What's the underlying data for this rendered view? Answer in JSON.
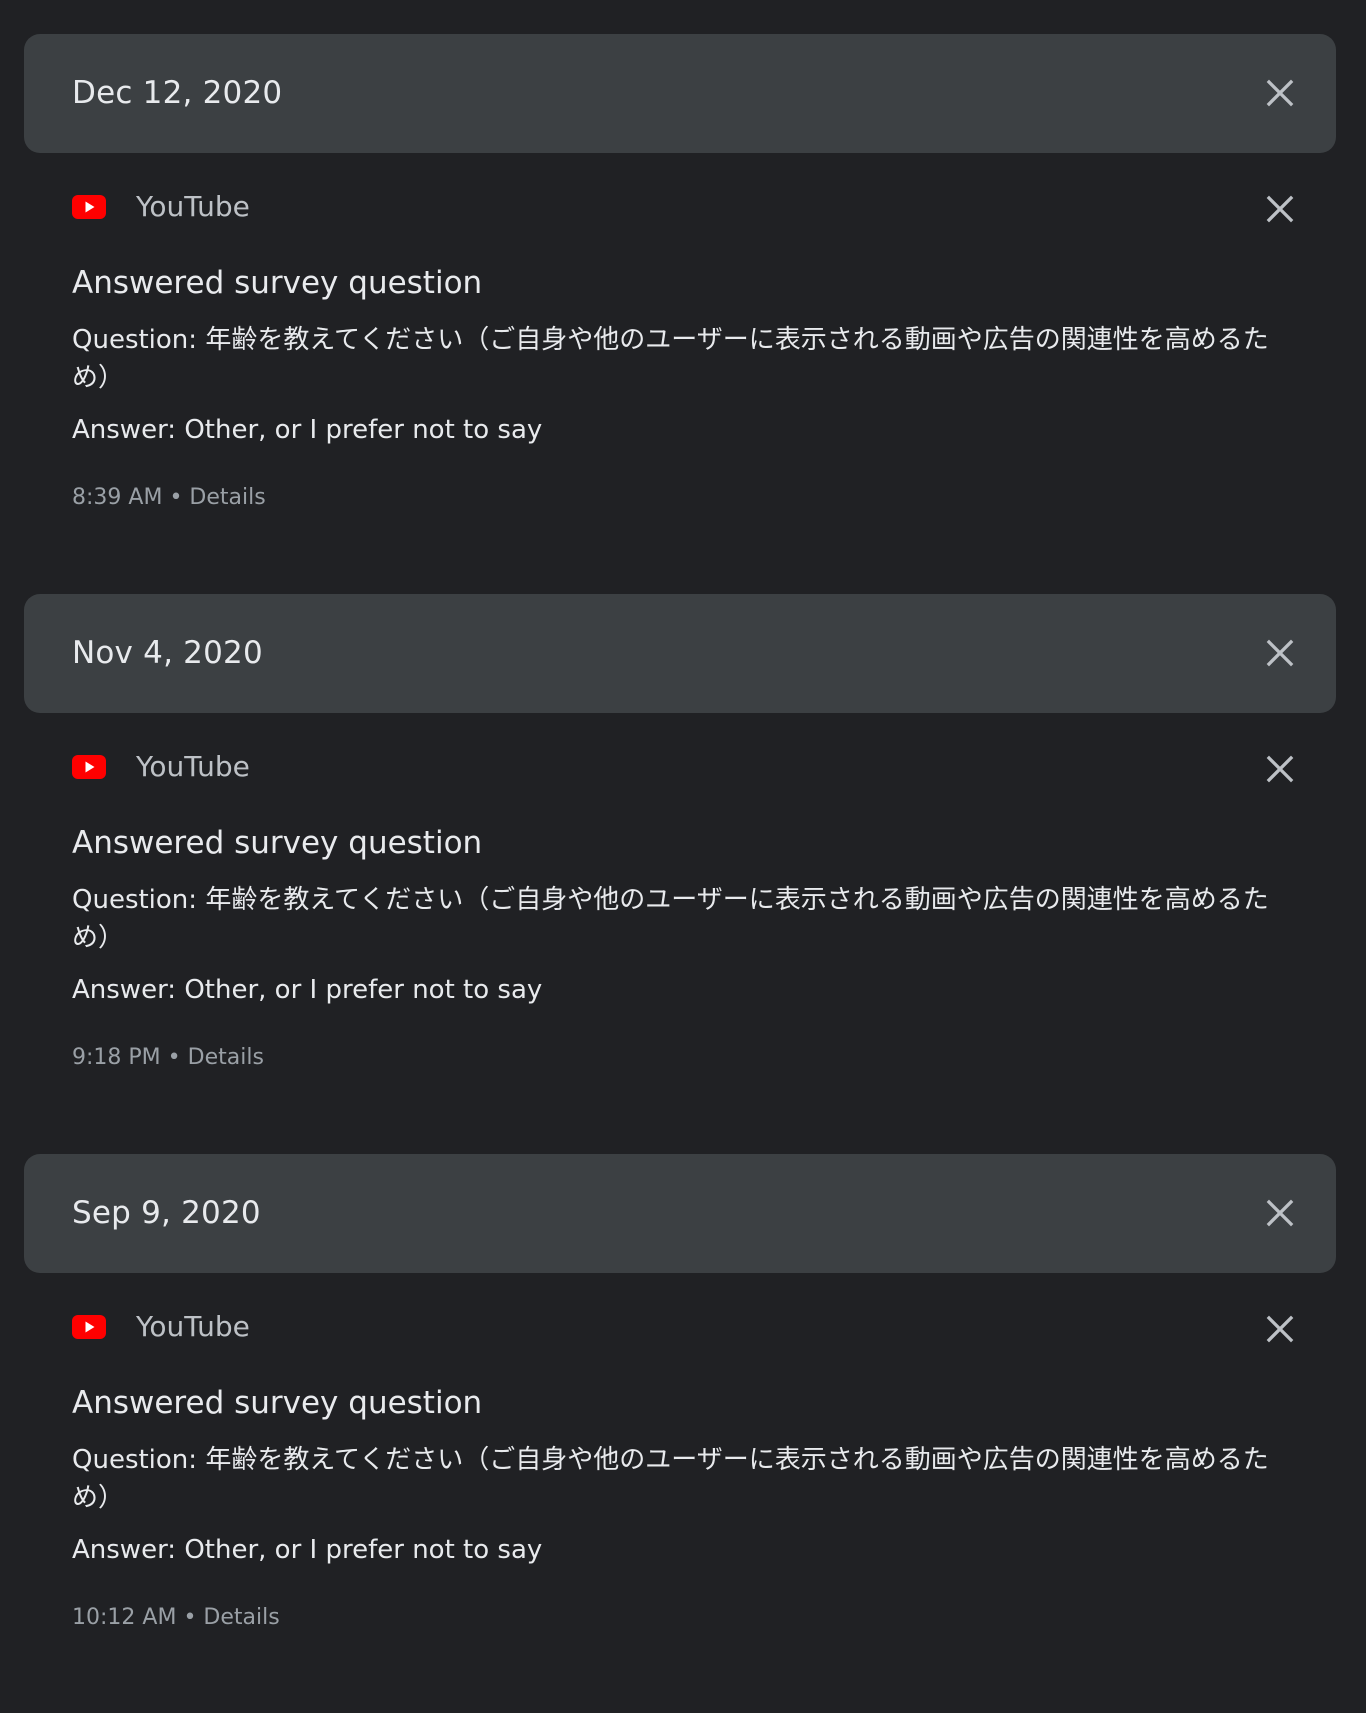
{
  "colors": {
    "background": "#202124",
    "header_bg": "#3c4043",
    "youtube_red": "#ff0000",
    "text_primary": "#e8eaed",
    "text_secondary": "#9aa0a6"
  },
  "groups": [
    {
      "date": "Dec 12, 2020",
      "item": {
        "product": "YouTube",
        "product_icon": "youtube-icon",
        "title": "Answered survey question",
        "question": "Question: 年齢を教えてください（ご自身や他のユーザーに表示される動画や広告の関連性を高めるため）",
        "answer": "Answer: Other, or I prefer not to say",
        "time": "8:39 AM",
        "separator": "•",
        "details_label": "Details"
      }
    },
    {
      "date": "Nov 4, 2020",
      "item": {
        "product": "YouTube",
        "product_icon": "youtube-icon",
        "title": "Answered survey question",
        "question": "Question: 年齢を教えてください（ご自身や他のユーザーに表示される動画や広告の関連性を高めるため）",
        "answer": "Answer: Other, or I prefer not to say",
        "time": "9:18 PM",
        "separator": "•",
        "details_label": "Details"
      }
    },
    {
      "date": "Sep 9, 2020",
      "item": {
        "product": "YouTube",
        "product_icon": "youtube-icon",
        "title": "Answered survey question",
        "question": "Question: 年齢を教えてください（ご自身や他のユーザーに表示される動画や広告の関連性を高めるため）",
        "answer": "Answer: Other, or I prefer not to say",
        "time": "10:12 AM",
        "separator": "•",
        "details_label": "Details"
      }
    }
  ]
}
